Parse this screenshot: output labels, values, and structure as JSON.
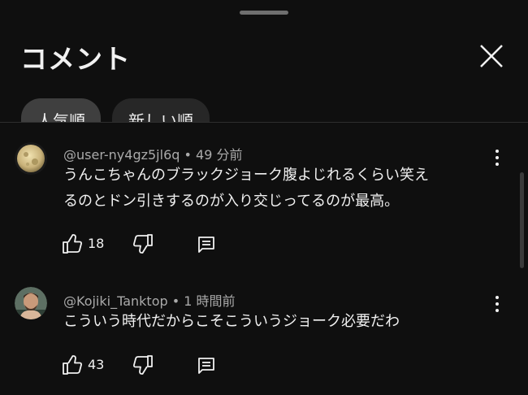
{
  "header": {
    "title": "コメント",
    "close_icon": "close-icon"
  },
  "chips": [
    {
      "label": "人気順",
      "active": true
    },
    {
      "label": "新しい順",
      "active": false
    }
  ],
  "comments": [
    {
      "author": "@user-ny4gz5jl6q",
      "separator": "•",
      "time": "49 分前",
      "lines": [
        "うんこちゃんのブラックジョーク腹よじれるくらい笑え",
        "るのとドン引きするのが入り交じってるのが最高。"
      ],
      "likes": "18",
      "avatar_icon": "moon-avatar"
    },
    {
      "author": "@Kojiki_Tanktop",
      "separator": "•",
      "time": "1 時間前",
      "lines": [
        "こういう時代だからこそこういうジョーク必要だわ"
      ],
      "likes": "43",
      "avatar_icon": "person-avatar"
    }
  ],
  "colors": {
    "background": "#0f0f0f",
    "text": "#f1f1f1",
    "secondary": "#aaaaaa",
    "chip_active": "#3f3f3f",
    "chip_inactive": "#272727"
  }
}
